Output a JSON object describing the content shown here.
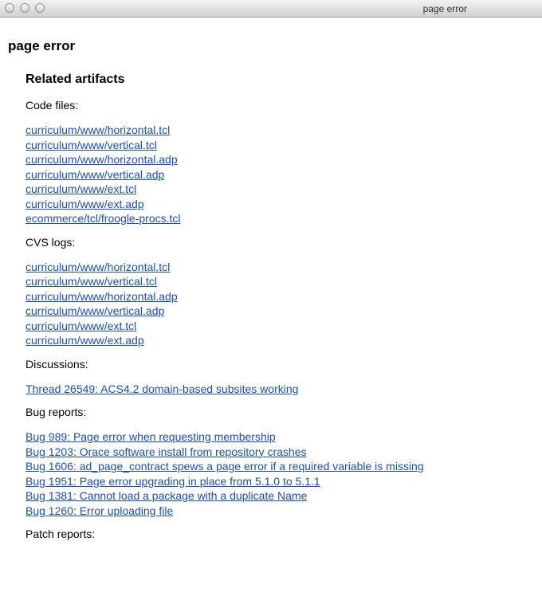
{
  "window": {
    "title": "page error"
  },
  "page": {
    "heading": "page error",
    "subheading": "Related artifacts"
  },
  "sections": {
    "code_files": {
      "label": "Code files:",
      "links": [
        "curriculum/www/horizontal.tcl",
        "curriculum/www/vertical.tcl",
        "curriculum/www/horizontal.adp",
        "curriculum/www/vertical.adp",
        "curriculum/www/ext.tcl",
        "curriculum/www/ext.adp",
        "ecommerce/tcl/froogle-procs.tcl"
      ]
    },
    "cvs_logs": {
      "label": "CVS logs:",
      "links": [
        "curriculum/www/horizontal.tcl",
        "curriculum/www/vertical.tcl",
        "curriculum/www/horizontal.adp",
        "curriculum/www/vertical.adp",
        "curriculum/www/ext.tcl",
        "curriculum/www/ext.adp"
      ]
    },
    "discussions": {
      "label": "Discussions:",
      "links": [
        "Thread 26549: ACS4.2 domain-based subsites working"
      ]
    },
    "bug_reports": {
      "label": "Bug reports:",
      "links": [
        "Bug 989: Page error when requesting membership",
        "Bug 1203: Orace software install from repository crashes",
        "Bug 1606: ad_page_contract spews a page error if a required variable is missing",
        "Bug 1951: Page error upgrading in place from 5.1.0 to 5.1.1",
        "Bug 1381: Cannot load a package with a duplicate Name",
        "Bug 1260: Error uploading file"
      ]
    },
    "patch_reports": {
      "label": "Patch reports:"
    }
  }
}
